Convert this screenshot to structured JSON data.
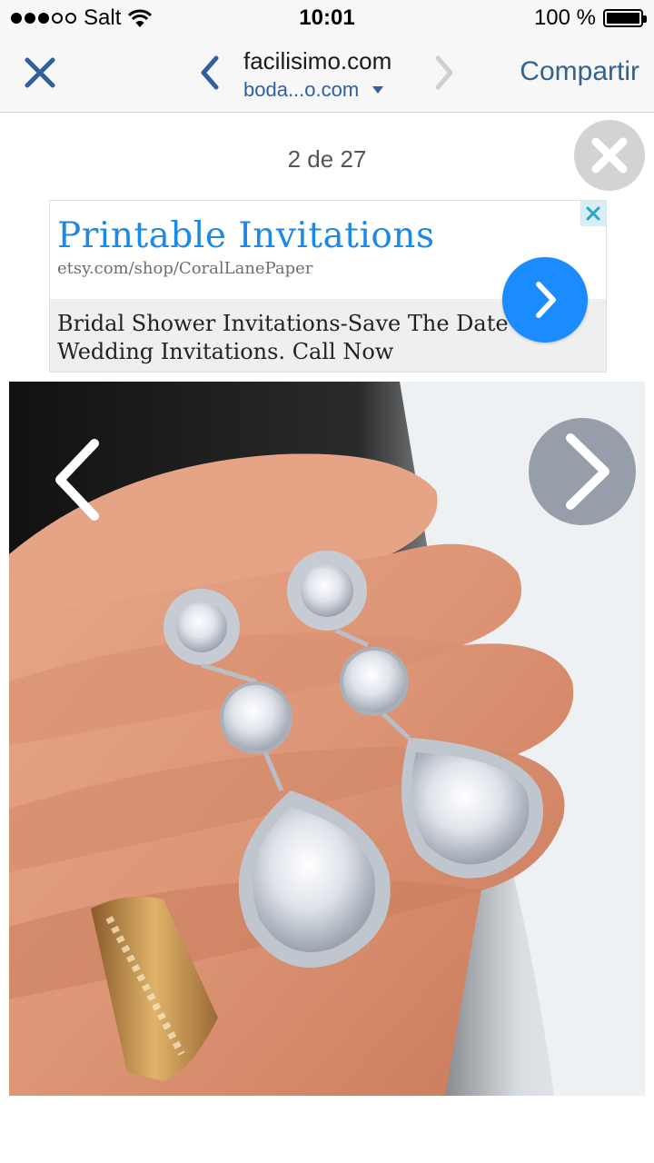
{
  "status_bar": {
    "carrier": "Salt",
    "time": "10:01",
    "battery_text": "100 %",
    "signal_bars_filled": 3,
    "signal_bars_total": 5,
    "battery_level": 1.0
  },
  "nav": {
    "host": "facilisimo.com",
    "subtitle": "boda...o.com",
    "share_label": "Compartir",
    "close_icon": "close-icon",
    "back_icon": "chevron-left-icon",
    "forward_icon": "chevron-right-icon"
  },
  "gallery": {
    "counter": "2 de 27",
    "close_icon": "close-circle-icon",
    "prev_icon": "chevron-left-icon",
    "next_icon": "chevron-right-icon"
  },
  "ad": {
    "title": "Printable Invitations",
    "url": "etsy.com/shop/CoralLanePaper",
    "description_line1": "Bridal Shower Invitations-Save The Date",
    "description_line2": "Wedding Invitations. Call Now",
    "close_icon": "ad-close-icon",
    "go_icon": "chevron-right-icon"
  },
  "colors": {
    "link_blue": "#34628f",
    "ad_title_blue": "#1e88e5",
    "ad_button_blue": "#1a8cff"
  }
}
